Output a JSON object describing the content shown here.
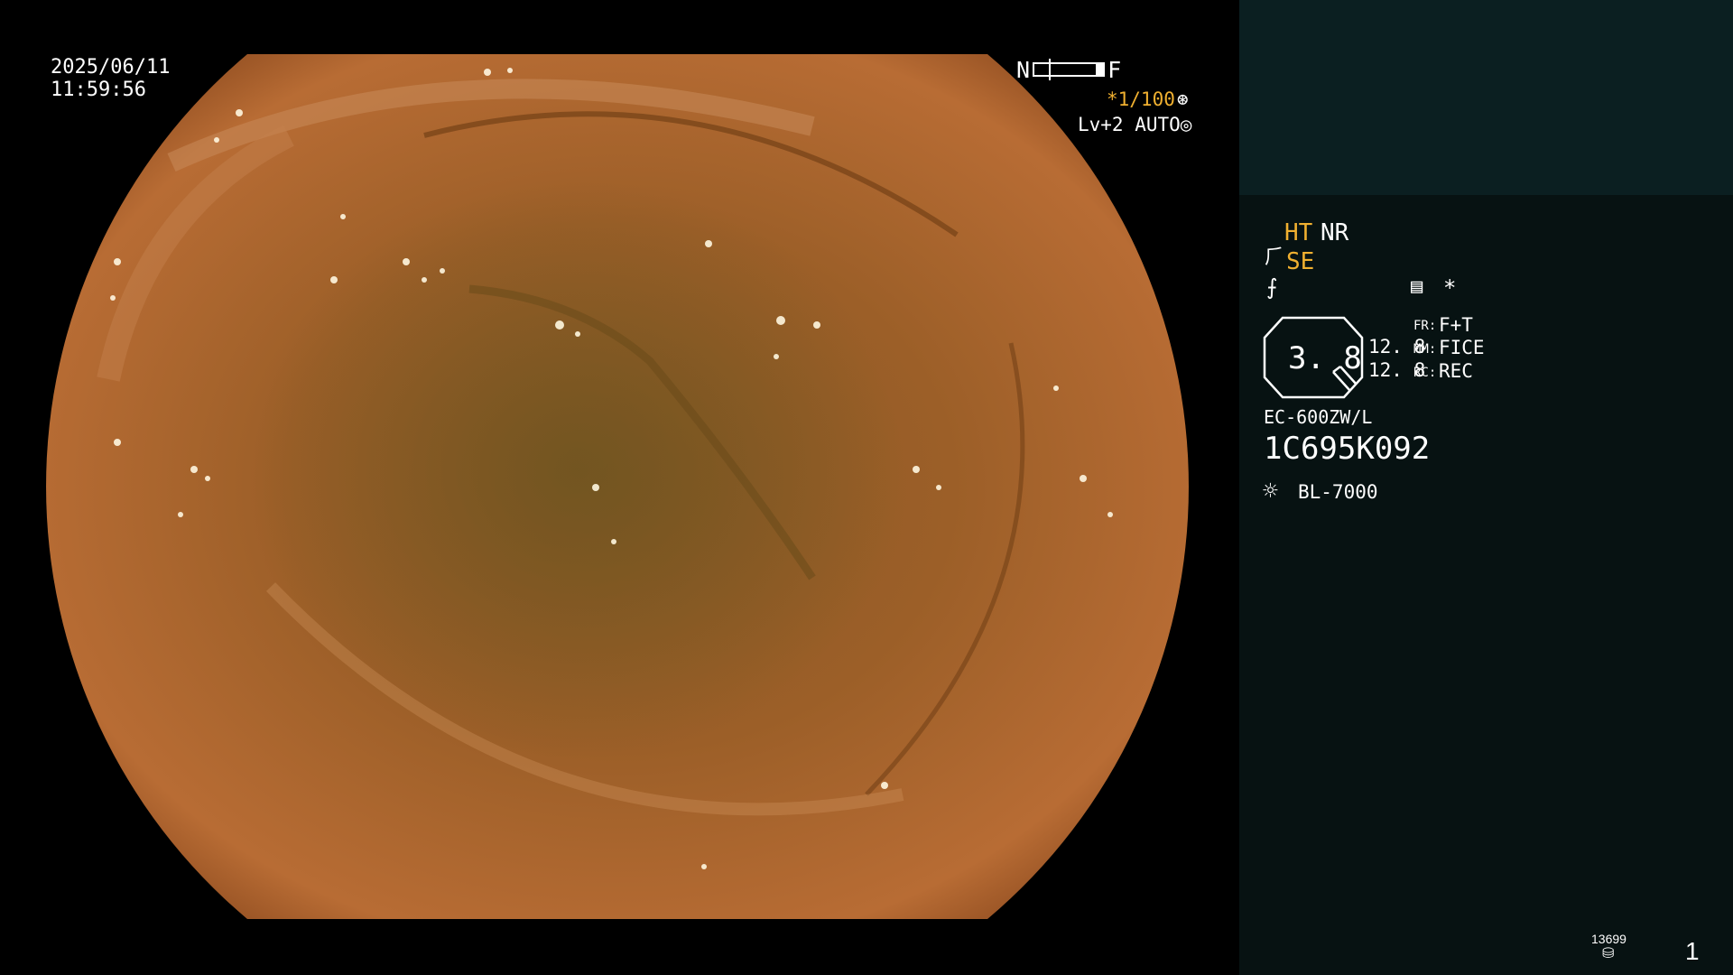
{
  "overlay": {
    "date": "2025/06/11",
    "time": "11:59:56",
    "near_label": "N",
    "far_label": "F",
    "shutter": "*1/100",
    "shutter_icon": "⊛",
    "iris": "Lv+2 AUTO",
    "iris_icon": "◎"
  },
  "panel": {
    "ht": "HT",
    "nr": "NR",
    "se_icon": "⺁",
    "se": "SE",
    "structure_icon": "⨍",
    "list_icon": "▤",
    "star": "*",
    "zoom": "3. 8",
    "value1": "12. 8",
    "value2": "12. 8",
    "fr_label": "FR:",
    "fr_value": "F+T",
    "mm_label": "MM:",
    "mm_value": "FICE",
    "rc_label": "RC:",
    "rc_value": "REC",
    "scope_model": "EC-600ZW/L",
    "scope_serial": "1C695K092",
    "light_icon": "☼",
    "light_source": "BL-7000",
    "counter": "13699",
    "disk_icon": "⛁",
    "page": "1"
  },
  "colors": {
    "accent": "#f0b030",
    "panel_bg": "#071212",
    "panel_top_bg": "#0b1f21",
    "mucosa": "#a86128"
  },
  "icons": {
    "shutter": "shutter-icon",
    "iris": "iris-icon",
    "se": "se-icon",
    "structure": "structure-icon",
    "list": "list-icon",
    "light": "light-source-icon",
    "disk": "disk-icon"
  }
}
